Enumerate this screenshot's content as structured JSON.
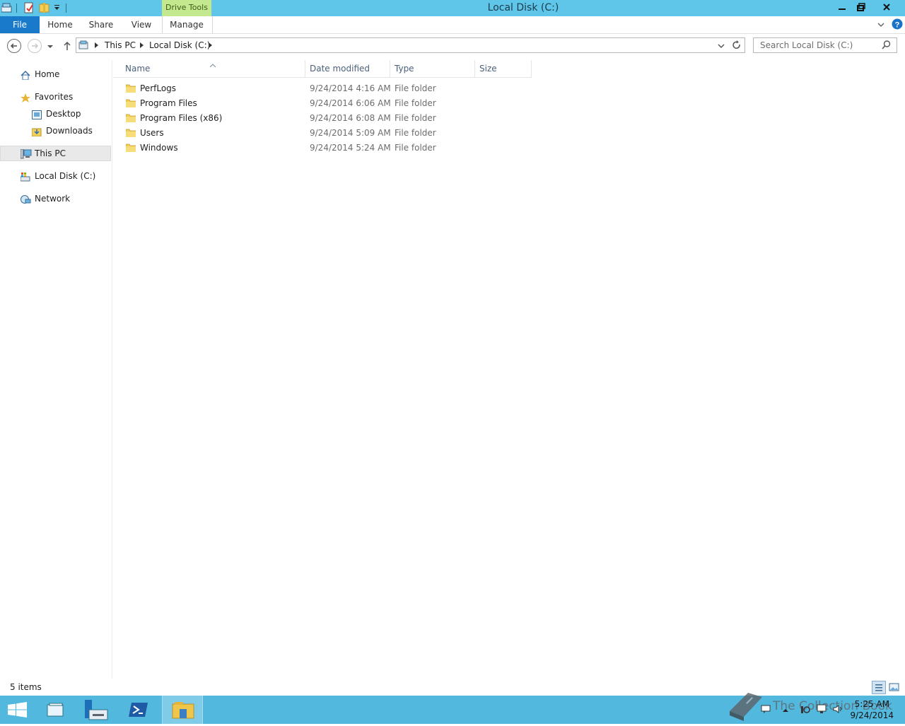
{
  "window": {
    "title": "Local Disk (C:)",
    "context_tab_group": "Drive Tools",
    "controls": [
      "minimize",
      "restore",
      "close"
    ]
  },
  "ribbon": {
    "tabs": [
      "File",
      "Home",
      "Share",
      "View",
      "Manage"
    ]
  },
  "address": {
    "crumbs": [
      "This PC",
      "Local Disk (C:)"
    ],
    "search_placeholder": "Search Local Disk (C:)"
  },
  "nav_pane": {
    "home": "Home",
    "favorites": "Favorites",
    "desktop": "Desktop",
    "downloads": "Downloads",
    "this_pc": "This PC",
    "local_disk": "Local Disk (C:)",
    "network": "Network"
  },
  "columns": {
    "name": "Name",
    "date": "Date modified",
    "type": "Type",
    "size": "Size"
  },
  "files": [
    {
      "name": "PerfLogs",
      "date": "9/24/2014 4:16 AM",
      "type": "File folder"
    },
    {
      "name": "Program Files",
      "date": "9/24/2014 6:06 AM",
      "type": "File folder"
    },
    {
      "name": "Program Files (x86)",
      "date": "9/24/2014 6:08 AM",
      "type": "File folder"
    },
    {
      "name": "Users",
      "date": "9/24/2014 5:09 AM",
      "type": "File folder"
    },
    {
      "name": "Windows",
      "date": "9/24/2014 5:24 AM",
      "type": "File folder"
    }
  ],
  "status": {
    "item_count": "5 items"
  },
  "taskbar": {
    "time": "5:25 AM",
    "date": "9/24/2014",
    "watermark": "The Collection Book"
  },
  "colors": {
    "titlebar": "#5fc6e9",
    "file_tab": "#1979ca",
    "drive_tools": "#c3e88e",
    "taskbar": "#52b8dd"
  }
}
